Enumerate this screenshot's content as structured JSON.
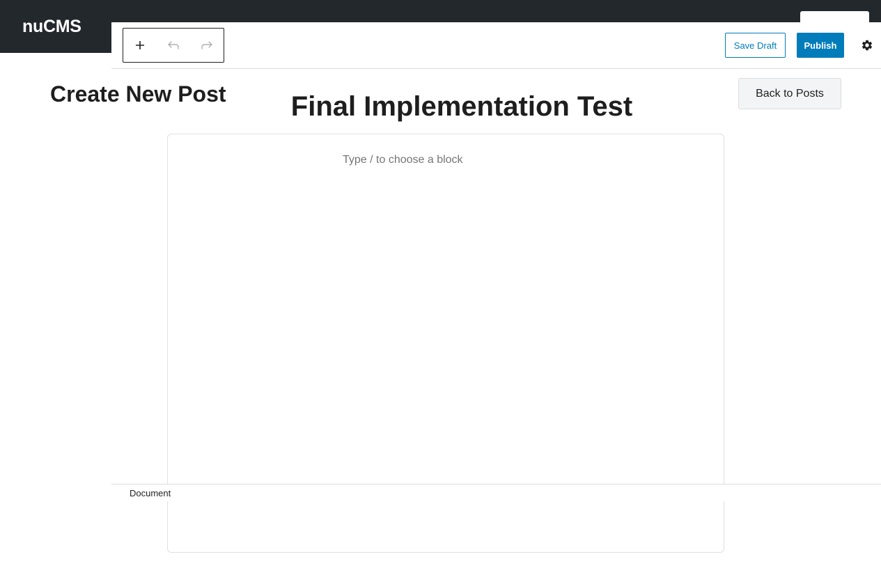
{
  "site": {
    "name": "nuCMS"
  },
  "page": {
    "title": "Create New Post",
    "back_label": "Back to Posts"
  },
  "toolbar": {
    "icons": [
      "plus-icon",
      "undo-icon",
      "redo-icon",
      "gear-icon"
    ],
    "save_draft_label": "Save Draft",
    "publish_label": "Publish"
  },
  "editor": {
    "post_title": "Final Implementation Test",
    "block_placeholder": "Type / to choose a block"
  },
  "footer": {
    "document_label": "Document"
  },
  "colors": {
    "header_bg": "#23282d",
    "accent": "#007cba"
  }
}
